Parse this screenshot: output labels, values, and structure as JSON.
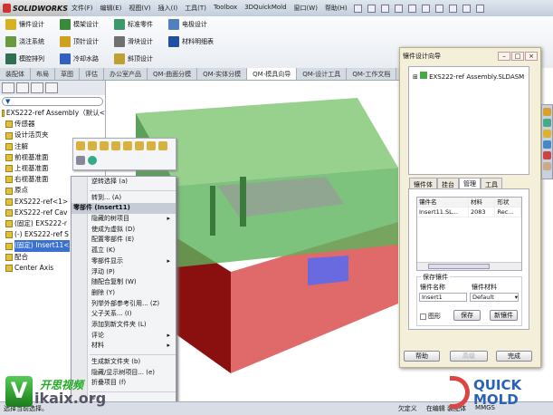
{
  "app": {
    "logo": "SOLIDWORKS"
  },
  "menu": [
    "文件(F)",
    "编辑(E)",
    "视图(V)",
    "插入(I)",
    "工具(T)",
    "Toolbox",
    "3DQuickMold",
    "窗口(W)",
    "帮助(H)"
  ],
  "ribbon": [
    {
      "label": "镶件设计",
      "color": "#d9b020"
    },
    {
      "label": "模架设计",
      "color": "#3a8a3a"
    },
    {
      "label": "标准零件",
      "color": "#3a9a6a"
    },
    {
      "label": "电极设计",
      "color": "#5080c0"
    },
    {
      "label": "浇注系统",
      "color": "#6a9a40"
    },
    {
      "label": "顶针设计",
      "color": "#d0a020"
    },
    {
      "label": "滑块设计",
      "color": "#707070"
    },
    {
      "label": "材料明细表",
      "color": "#2050a0"
    },
    {
      "label": "模腔排列",
      "color": "#307050"
    },
    {
      "label": "冷却水路",
      "color": "#3060c0"
    },
    {
      "label": "斜顶设计",
      "color": "#c0a030"
    }
  ],
  "tabs": [
    {
      "label": "装配体"
    },
    {
      "label": "布局"
    },
    {
      "label": "草图"
    },
    {
      "label": "评估"
    },
    {
      "label": "办公室产品"
    },
    {
      "label": "QM-曲面分模"
    },
    {
      "label": "QM-实体分模"
    },
    {
      "label": "QM-模具向导",
      "active": true
    },
    {
      "label": "QM-设计工具"
    },
    {
      "label": "QM-工作文档"
    }
  ],
  "tree": {
    "filter": "▼",
    "items": [
      "EXS222-ref Assembly（默认<",
      "传感器",
      "设计活页夹",
      "注解",
      "前视基准面",
      "上视基准面",
      "右视基准面",
      "原点",
      "EXS222-ref<1>",
      "EXS222-ref Cav",
      "(固定) EXS222-r",
      "(-) EXS222-ref S",
      "(固定) Insert11<",
      "配合",
      "Center Axis"
    ]
  },
  "context_menu": {
    "items": [
      {
        "label": "逆转选择 (a)"
      },
      {
        "sep": true
      },
      {
        "label": "转到... (A)"
      },
      {
        "label": "零部件 (Insert11)",
        "header": true
      },
      {
        "label": "隐藏的树项目",
        "sub": true
      },
      {
        "label": "使成为虚拟 (D)"
      },
      {
        "label": "配置零部件 (E)"
      },
      {
        "label": "孤立 (K)"
      },
      {
        "label": "零部件显示",
        "sub": true
      },
      {
        "label": "浮动 (P)"
      },
      {
        "label": "随配合复制 (W)"
      },
      {
        "label": "删除 (Y)"
      },
      {
        "label": "列举外部参考引用... (Z)"
      },
      {
        "label": "父子关系... (I)"
      },
      {
        "label": "添加到新文件夹 (L)"
      },
      {
        "label": "评论",
        "sub": true
      },
      {
        "label": "材料",
        "sub": true
      },
      {
        "sep": true
      },
      {
        "label": "生成新文件夹 (b)"
      },
      {
        "label": "隐藏/显示树项目... (e)"
      },
      {
        "label": "折叠项目 (f)"
      },
      {
        "sep": true
      },
      {
        "label": "»"
      }
    ]
  },
  "dialog": {
    "title": "镶件设计向导",
    "tree_root": "EXS222-ref Assembly.SLDASM",
    "tabs": [
      "镶件体",
      "挂台",
      "管理",
      "工具"
    ],
    "active_tab": "管理",
    "table": {
      "headers": [
        "镶件名",
        "材料",
        "形状"
      ],
      "rows": [
        [
          "Insert11.SL...",
          "2083",
          "Rec..."
        ]
      ]
    },
    "save_group": "保存镶件",
    "name_label": "镶件名称",
    "material_label": "镶件材料",
    "name_value": "Insert1",
    "material_value": "Default",
    "checkbox": "图形",
    "save": "保存",
    "new": "新镶件",
    "help": "帮助",
    "advanced": "高级",
    "finish": "完成"
  },
  "status": {
    "left": "选择当前选择。",
    "underdefined": "欠定义",
    "editing": "在编辑 装配体",
    "units": "MMGS"
  },
  "watermark": {
    "site": "开思视频",
    "domain": "ikaix.org",
    "brand1": "QUICK",
    "brand2": "MOLD"
  }
}
